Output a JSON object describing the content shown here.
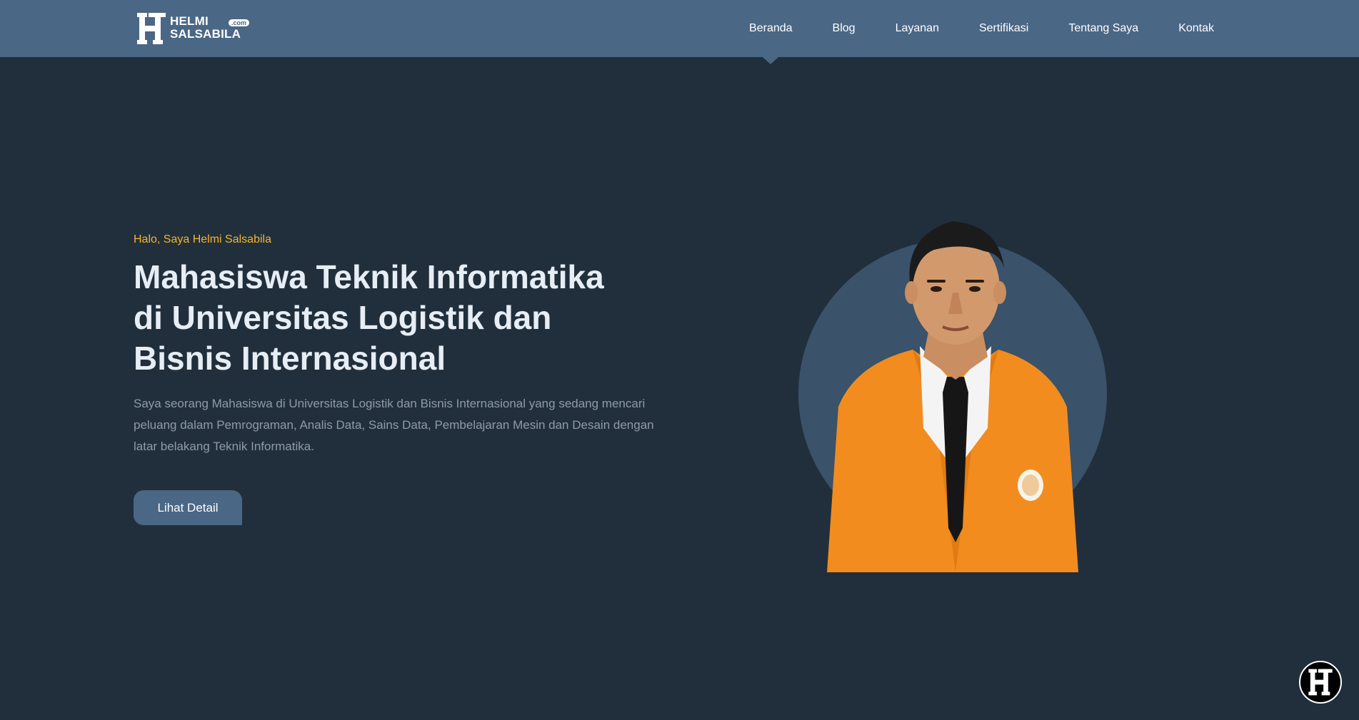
{
  "brand": {
    "line1": "HELMI",
    "line2": "SALSABILA",
    "tld": ".com"
  },
  "nav": {
    "items": [
      {
        "label": "Beranda",
        "active": true
      },
      {
        "label": "Blog"
      },
      {
        "label": "Layanan"
      },
      {
        "label": "Sertifikasi"
      },
      {
        "label": "Tentang Saya"
      },
      {
        "label": "Kontak"
      }
    ]
  },
  "hero": {
    "greeting": "Halo, Saya Helmi Salsabila",
    "title_lines": [
      "Mahasiswa Teknik Informatika",
      "di Universitas Logistik dan",
      "Bisnis Internasional"
    ],
    "description": "Saya seorang Mahasiswa di Universitas Logistik dan Bisnis Internasional yang sedang mencari peluang dalam Pemrograman, Analis Data, Sains Data, Pembelajaran Mesin dan Desain dengan latar belakang Teknik Informatika.",
    "button_label": "Lihat Detail",
    "portrait_icon": "person-portrait-orange-jacket"
  },
  "floating": {
    "icon": "h-logo-icon"
  },
  "colors": {
    "header_bg": "#4a6785",
    "page_bg": "#212f3c",
    "accent": "#f5b52c",
    "jacket": "#f28c1f"
  }
}
